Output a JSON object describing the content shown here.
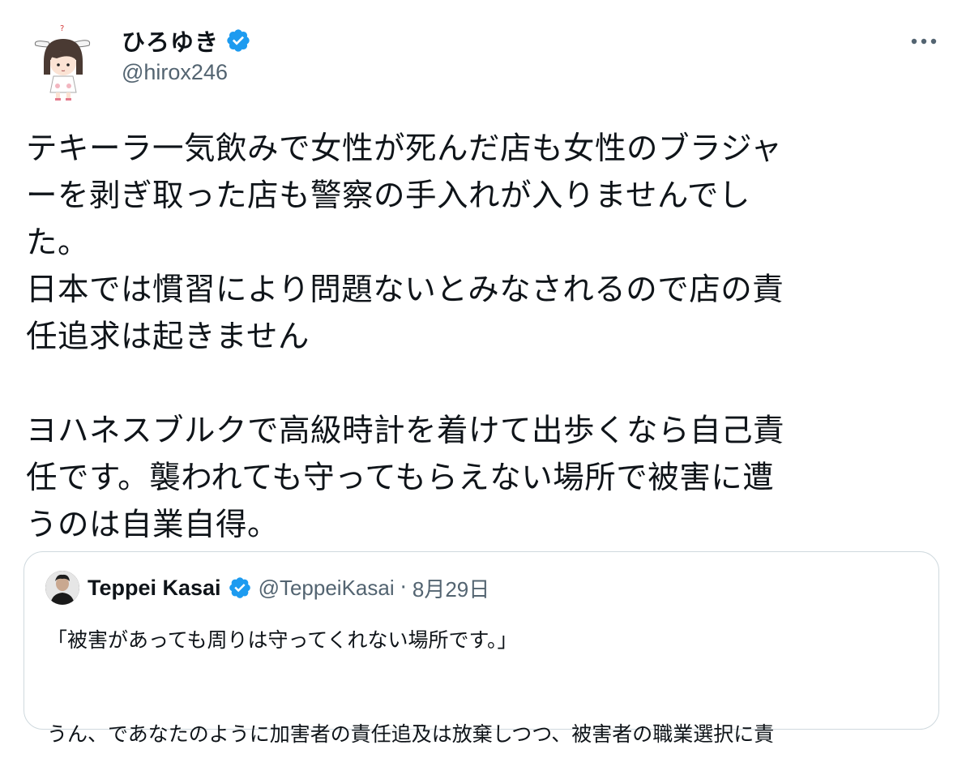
{
  "tweet": {
    "display_name": "ひろゆき",
    "handle": "@hirox246",
    "more_label": "•••",
    "body": "テキーラ一気飲みで女性が死んだ店も女性のブラジャ\nーを剥ぎ取った店も警察の手入れが入りませんでし\nた。\n日本では慣習により問題ないとみなされるので店の責\n任追求は起きません\n\nヨハネスブルクで高級時計を着けて出歩くなら自己責\n任です。襲われても守ってもらえない場所で被害に遭\nうのは自業自得。"
  },
  "quote": {
    "display_name": "Teppei Kasai",
    "handle": "@TeppeiKasai",
    "separator": "·",
    "date": "8月29日",
    "body": "「被害があっても周りは守ってくれない場所です。」\n\nうん、であなたのように加害者の責任追及は放棄しつつ、被害者の職業選択に責"
  },
  "colors": {
    "verified": "#1d9bf0",
    "text_primary": "#0f1419",
    "text_secondary": "#536471",
    "border": "#cfd9de"
  },
  "icons": {
    "verified": "verified-badge-icon",
    "more": "more-horizontal-icon"
  }
}
